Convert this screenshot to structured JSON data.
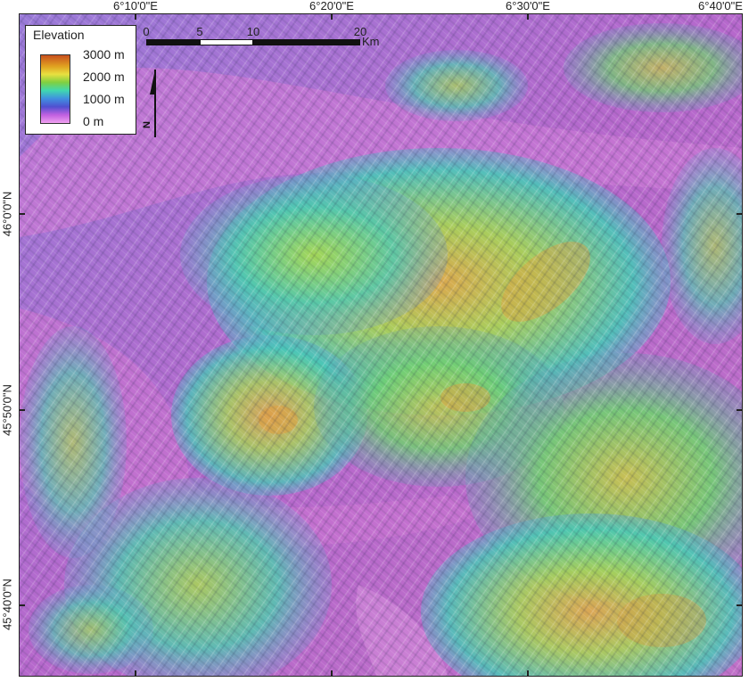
{
  "map": {
    "title": "",
    "legend": {
      "title": "Elevation",
      "entries": [
        "3000 m",
        "2000 m",
        "1000 m",
        "0 m"
      ]
    },
    "scale_bar": {
      "ticks": [
        "0",
        "5",
        "10",
        "20"
      ],
      "unit": "Km"
    },
    "north_arrow": {
      "label": "N"
    },
    "longitude_labels": [
      "6°10'0\"E",
      "6°20'0\"E",
      "6°30'0\"E",
      "6°40'0\"E"
    ],
    "latitude_labels": [
      "46°0'0\"N",
      "45°50'0\"N",
      "45°40'0\"N"
    ],
    "colors": {
      "lowland": "#c070d0",
      "valley": "#b060c8",
      "mid": "#40c8c0",
      "high": "#a0d850",
      "peak": "#e0a040"
    }
  }
}
